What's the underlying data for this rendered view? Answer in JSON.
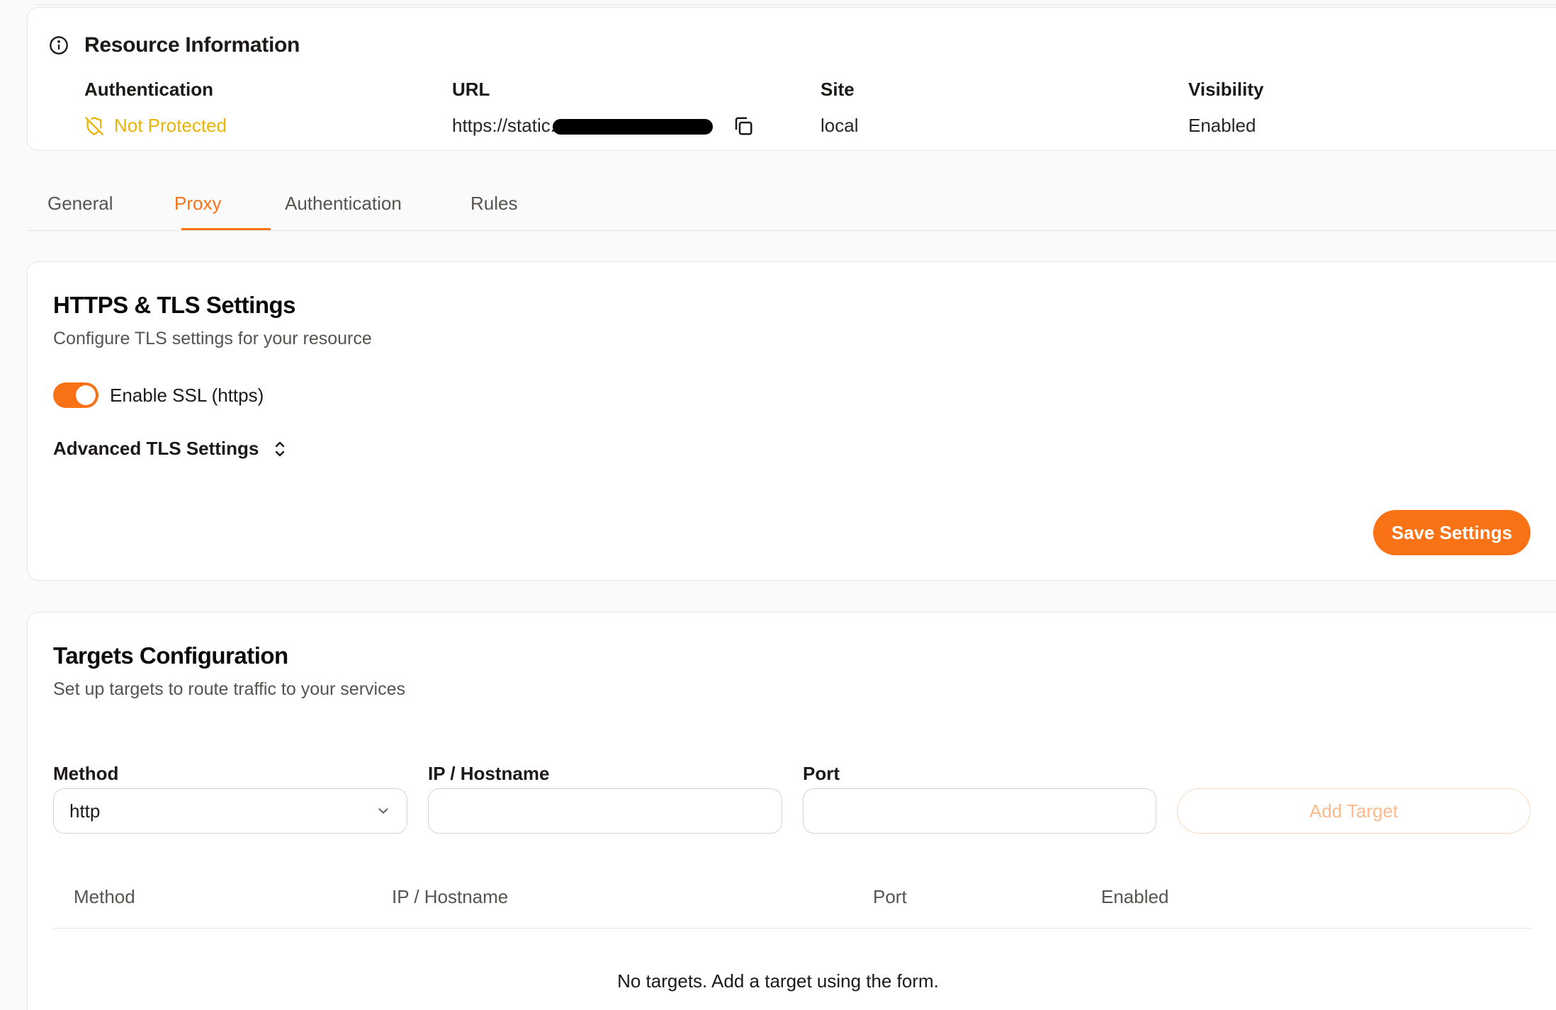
{
  "resource_info": {
    "title": "Resource Information",
    "icon": "info-icon",
    "authentication": {
      "label": "Authentication",
      "value": "Not Protected",
      "color": "#eab308",
      "icon": "shield-off-icon"
    },
    "url": {
      "label": "URL",
      "value_prefix": "https://static.",
      "copy_icon": "copy-icon"
    },
    "site": {
      "label": "Site",
      "value": "local"
    },
    "visibility": {
      "label": "Visibility",
      "value": "Enabled"
    }
  },
  "tabs": [
    {
      "label": "General",
      "active": false
    },
    {
      "label": "Proxy",
      "active": true
    },
    {
      "label": "Authentication",
      "active": false
    },
    {
      "label": "Rules",
      "active": false
    }
  ],
  "tls": {
    "title": "HTTPS & TLS Settings",
    "subtitle": "Configure TLS settings for your resource",
    "ssl_toggle": {
      "label": "Enable SSL (https)",
      "checked": true
    },
    "advanced_label": "Advanced TLS Settings",
    "save_label": "Save Settings"
  },
  "targets": {
    "title": "Targets Configuration",
    "subtitle": "Set up targets to route traffic to your services",
    "form": {
      "method_label": "Method",
      "method_value": "http",
      "host_label": "IP / Hostname",
      "host_value": "",
      "port_label": "Port",
      "port_value": "",
      "add_label": "Add Target"
    },
    "table": {
      "columns": [
        "Method",
        "IP / Hostname",
        "Port",
        "Enabled"
      ],
      "empty_message": "No targets. Add a target using the form."
    }
  },
  "colors": {
    "accent": "#f97316",
    "warning": "#eab308"
  }
}
